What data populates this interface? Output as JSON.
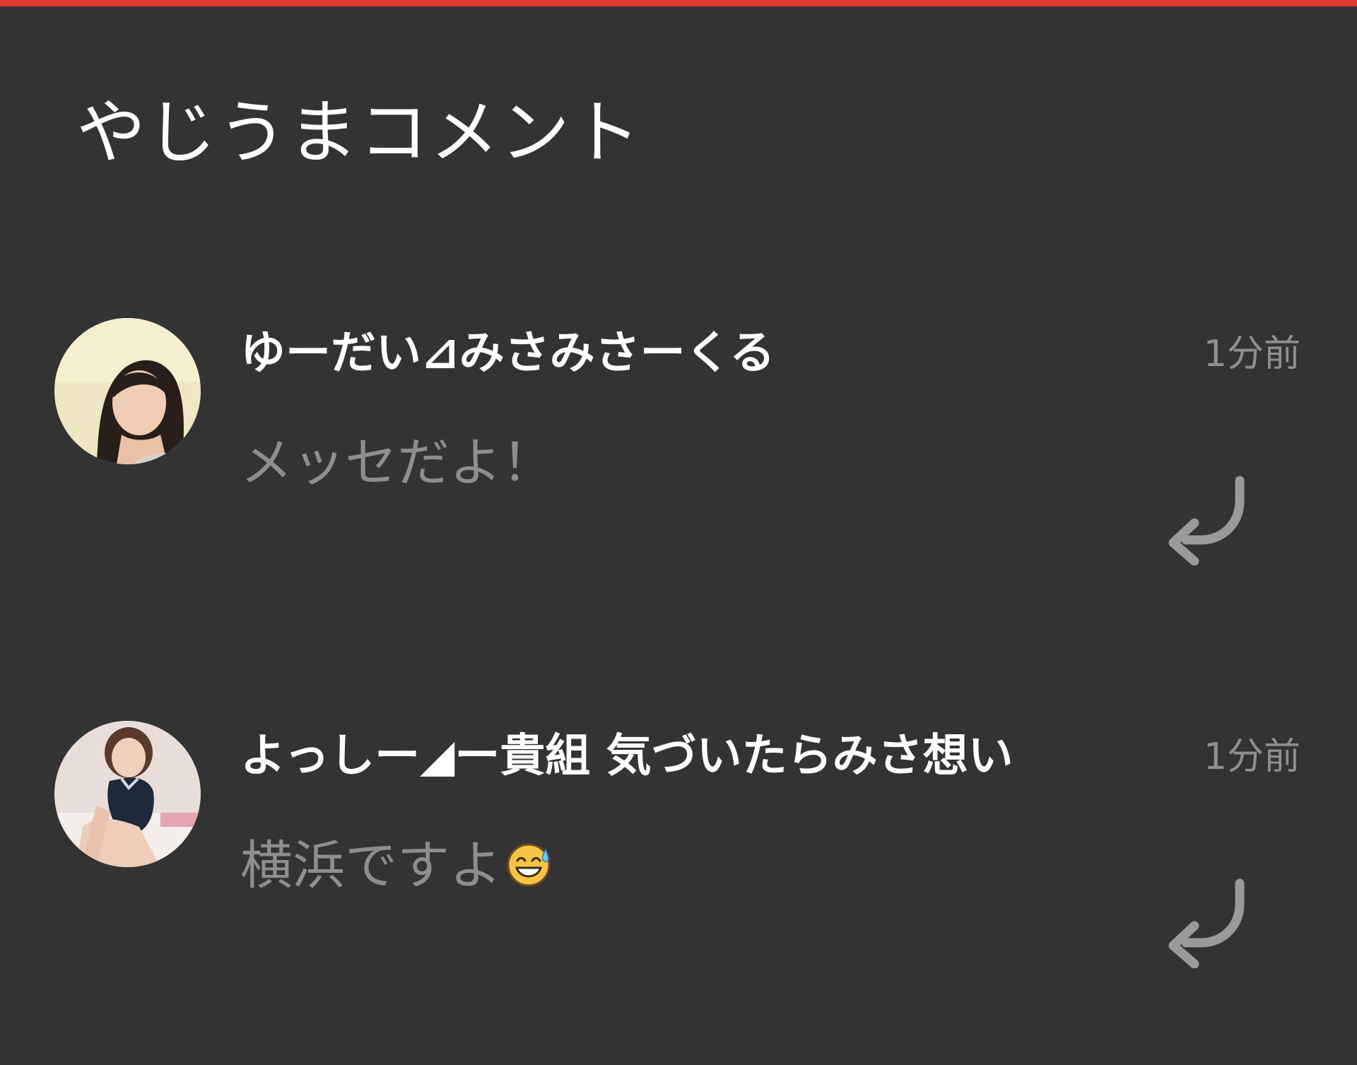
{
  "header": {
    "accent_color": "#e53a2f",
    "title": "やじうまコメント"
  },
  "comments": [
    {
      "username": "ゆーだい⊿みさみさーくる",
      "time": "1分前",
      "message": "メッセだよ！",
      "reply_icon": "reply-arrow-icon"
    },
    {
      "username": "よっしー◢ー貴組 気づいたらみさ想い",
      "time": "1分前",
      "message": "横浜ですよ",
      "emoji": "grinning-sweat-emoji",
      "reply_icon": "reply-arrow-icon"
    }
  ],
  "colors": {
    "background": "#333333",
    "username": "#ffffff",
    "message": "#8e8e8e",
    "timestamp": "#8f8f8f",
    "reply_icon": "#9a9a9a"
  }
}
